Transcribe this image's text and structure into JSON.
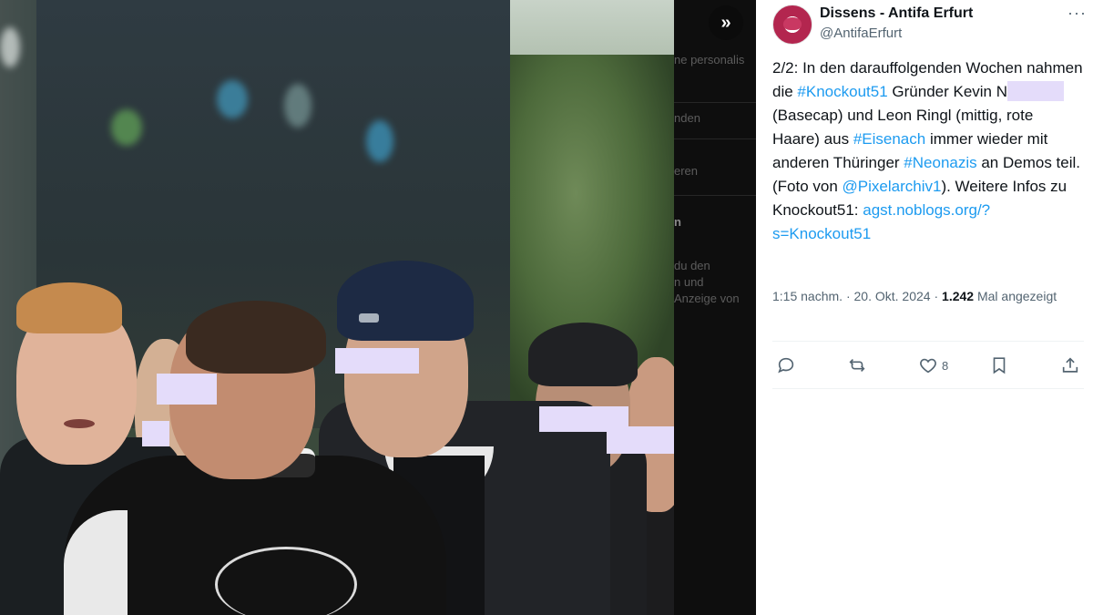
{
  "tweet": {
    "display_name": "Dissens - Antifa Erfurt",
    "handle": "@AntifaErfurt",
    "text": {
      "t1": "2/2: In den darauffolgenden Wochen nahmen die ",
      "l1": "#Knockout51",
      "t2": " Gründer Kevin N",
      "t3": " (Basecap) und Leon Ringl (mittig, rote Haare) aus ",
      "l2": "#Eisenach",
      "t4": " immer wieder mit anderen Thüringer ",
      "l3": "#Neonazis",
      "t5": " an Demos teil. (Foto von ",
      "l4": "@Pixelarchiv1",
      "t6": "). Weitere Infos zu Knockout51: ",
      "l5": "agst.noblogs.org/?s=Knockout51"
    },
    "time": "1:15 nachm.",
    "date": "20. Okt. 2024",
    "views_count": "1.242",
    "views_label": "Mal angezeigt",
    "likes": "8"
  },
  "background_ui": {
    "lines": [
      "ne personalis",
      "nden",
      "eren",
      "n",
      "du den",
      "n und",
      "Anzeige von"
    ]
  },
  "icons": {
    "expand": "double-chevron-right-icon",
    "more": "more-icon",
    "reply": "reply-icon",
    "repost": "repost-icon",
    "like": "heart-icon",
    "bookmark": "bookmark-icon",
    "share": "share-icon"
  },
  "colors": {
    "link": "#1d9bf0",
    "text": "#0f1419",
    "muted": "#536471",
    "redaction": "#e4dcfa"
  }
}
